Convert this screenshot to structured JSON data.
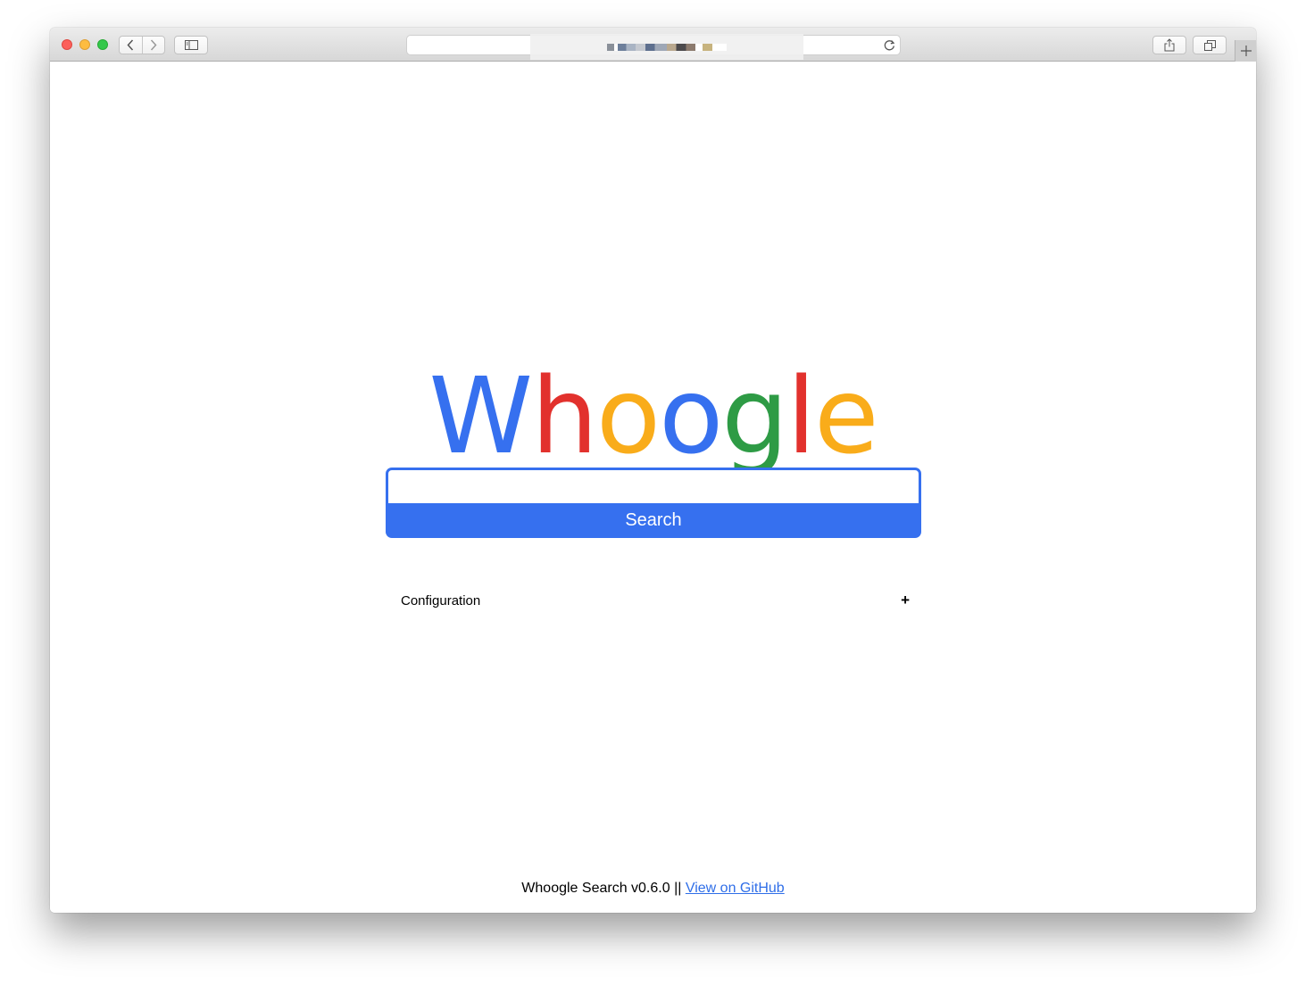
{
  "browser": {
    "back_icon": "chevron-left-icon",
    "forward_icon": "chevron-right-icon",
    "sidebar_icon": "sidebar-icon",
    "reload_icon": "reload-icon",
    "share_icon": "share-icon",
    "tabs_icon": "tabs-overview-icon",
    "new_tab_label": "+"
  },
  "logo": {
    "letters": [
      {
        "char": "W",
        "color": "#3670ef"
      },
      {
        "char": "h",
        "color": "#e2312d"
      },
      {
        "char": "o",
        "color": "#f9ac1a"
      },
      {
        "char": "o",
        "color": "#3670ef"
      },
      {
        "char": "g",
        "color": "#2e9b45"
      },
      {
        "char": "l",
        "color": "#e2312d"
      },
      {
        "char": "e",
        "color": "#f9ac1a"
      }
    ]
  },
  "search": {
    "value": "",
    "button_label": "Search"
  },
  "config": {
    "label": "Configuration",
    "toggle_label": "+"
  },
  "footer": {
    "text": "Whoogle Search v0.6.0 ||",
    "link_label": "View on GitHub"
  },
  "colors": {
    "accent": "#3670ef",
    "link": "#2f6ee8"
  }
}
